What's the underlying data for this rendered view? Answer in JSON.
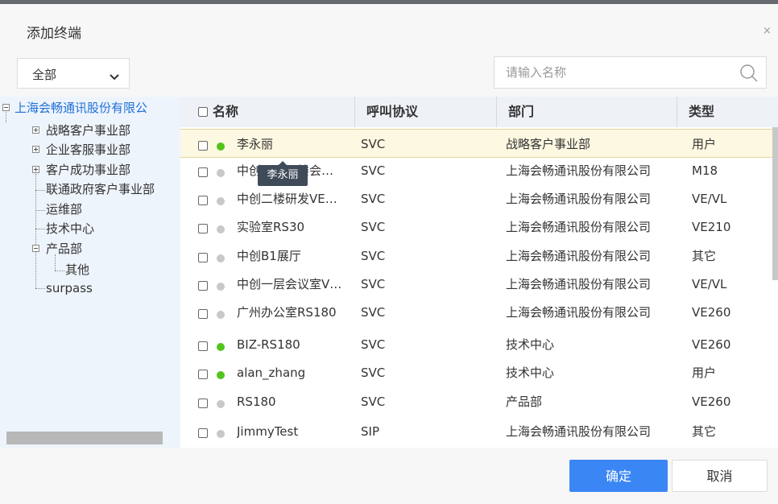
{
  "dialog": {
    "title": "添加终端",
    "close": "×"
  },
  "filter": {
    "selected": "全部",
    "search_placeholder": "请输入名称"
  },
  "tree": {
    "root": "上海会畅通讯股份有限公",
    "children": [
      {
        "label": "战略客户事业部"
      },
      {
        "label": "企业客服事业部"
      },
      {
        "label": "客户成功事业部"
      },
      {
        "label": "联通政府客户事业部"
      },
      {
        "label": "运维部"
      },
      {
        "label": "技术中心"
      },
      {
        "label": "产品部"
      },
      {
        "label": "其他"
      },
      {
        "label": "surpass"
      }
    ]
  },
  "table": {
    "headers": [
      "名称",
      "呼叫协议",
      "部门",
      "类型"
    ],
    "rows": [
      {
        "name": "李永丽",
        "protocol": "SVC",
        "dept": "战略客户事业部",
        "type": "用户",
        "status": "online"
      },
      {
        "name": "中创研发一楼会…",
        "protocol": "SVC",
        "dept": "上海会畅通讯股份有限公司",
        "type": "M18",
        "status": "offline"
      },
      {
        "name": "中创二楼研发VE…",
        "protocol": "SVC",
        "dept": "上海会畅通讯股份有限公司",
        "type": "VE/VL",
        "status": "offline"
      },
      {
        "name": "实验室RS30",
        "protocol": "SVC",
        "dept": "上海会畅通讯股份有限公司",
        "type": "VE210",
        "status": "offline"
      },
      {
        "name": "中创B1展厅",
        "protocol": "SVC",
        "dept": "上海会畅通讯股份有限公司",
        "type": "其它",
        "status": "offline"
      },
      {
        "name": "中创一层会议室V…",
        "protocol": "SVC",
        "dept": "上海会畅通讯股份有限公司",
        "type": "VE/VL",
        "status": "offline"
      },
      {
        "name": "广州办公室RS180",
        "protocol": "SVC",
        "dept": "上海会畅通讯股份有限公司",
        "type": "VE260",
        "status": "offline"
      },
      {
        "name": "BIZ-RS180",
        "protocol": "SVC",
        "dept": "技术中心",
        "type": "VE260",
        "status": "online"
      },
      {
        "name": "alan_zhang",
        "protocol": "SVC",
        "dept": "技术中心",
        "type": "用户",
        "status": "online"
      },
      {
        "name": "RS180",
        "protocol": "SVC",
        "dept": "产品部",
        "type": "VE260",
        "status": "offline"
      },
      {
        "name": "JimmyTest",
        "protocol": "SIP",
        "dept": "上海会畅通讯股份有限公司",
        "type": "其它",
        "status": "offline"
      }
    ]
  },
  "tooltip": {
    "text": "李永丽"
  },
  "colors": {
    "online": "#52c41a",
    "offline": "#c8c8c8",
    "primary": "#3b86f5",
    "highlight": "#fdf8e1"
  },
  "buttons": {
    "ok": "确定",
    "cancel": "取消"
  }
}
